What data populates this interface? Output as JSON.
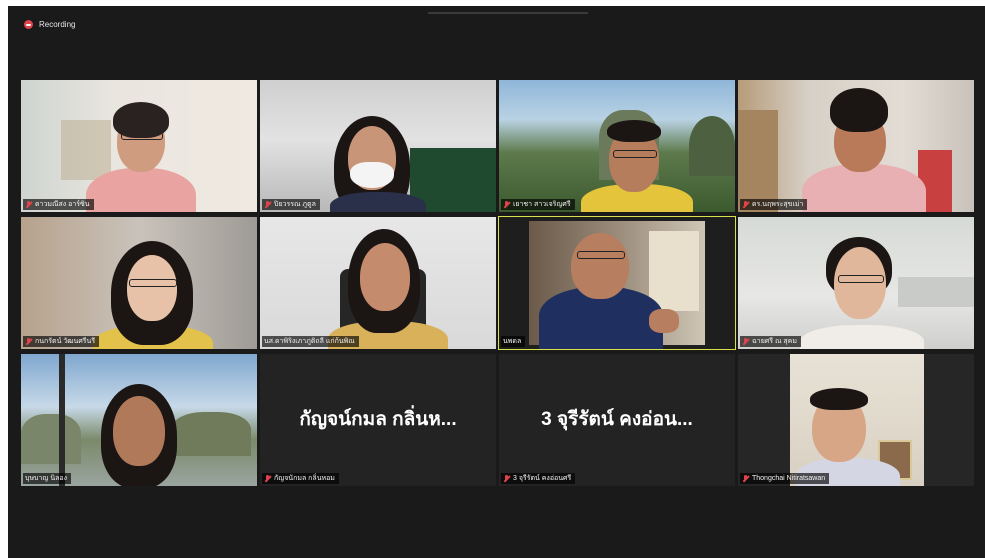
{
  "recording": {
    "label": "Recording"
  },
  "participants": [
    {
      "name": "ดาวมณีสง อาร์ซิน",
      "display": "",
      "muted": true
    },
    {
      "name": "ปิยวรรณ  ภูตูล",
      "display": "",
      "muted": true
    },
    {
      "name": "เยาชา สาวเจริญศรี",
      "display": "",
      "muted": true
    },
    {
      "name": "ดร.นฤพระสุขเม่า",
      "display": "",
      "muted": true
    },
    {
      "name": "กนกรัตน์ วัฒนศรีนรี",
      "display": "",
      "muted": true
    },
    {
      "name": "นส.ดาพิริงเภาภูติถลี แก่ก้นพิณ",
      "display": "",
      "muted": false
    },
    {
      "name": "นพดล",
      "display": "",
      "muted": false
    },
    {
      "name": "ฉายศรี ณ สุคม",
      "display": "",
      "muted": true
    },
    {
      "name": "บุษบาญ นิลอง",
      "display": "",
      "muted": false
    },
    {
      "name": "กัญจนักมล กลิ่นหอม",
      "display": "กัญจน์กมล กลิ่นห...",
      "muted": true
    },
    {
      "name": "3 จุรีรัตน์ คงอ่อนศรี",
      "display": "3 จุรีรัตน์ คงอ่อน...",
      "muted": true
    },
    {
      "name": "Thongchai Nitiratsawan",
      "display": "",
      "muted": true
    }
  ],
  "active_speaker_index": 6,
  "colors": {
    "active_border": "#d8e04a",
    "muted_icon": "#e0444a",
    "background": "#1a1a1a"
  }
}
